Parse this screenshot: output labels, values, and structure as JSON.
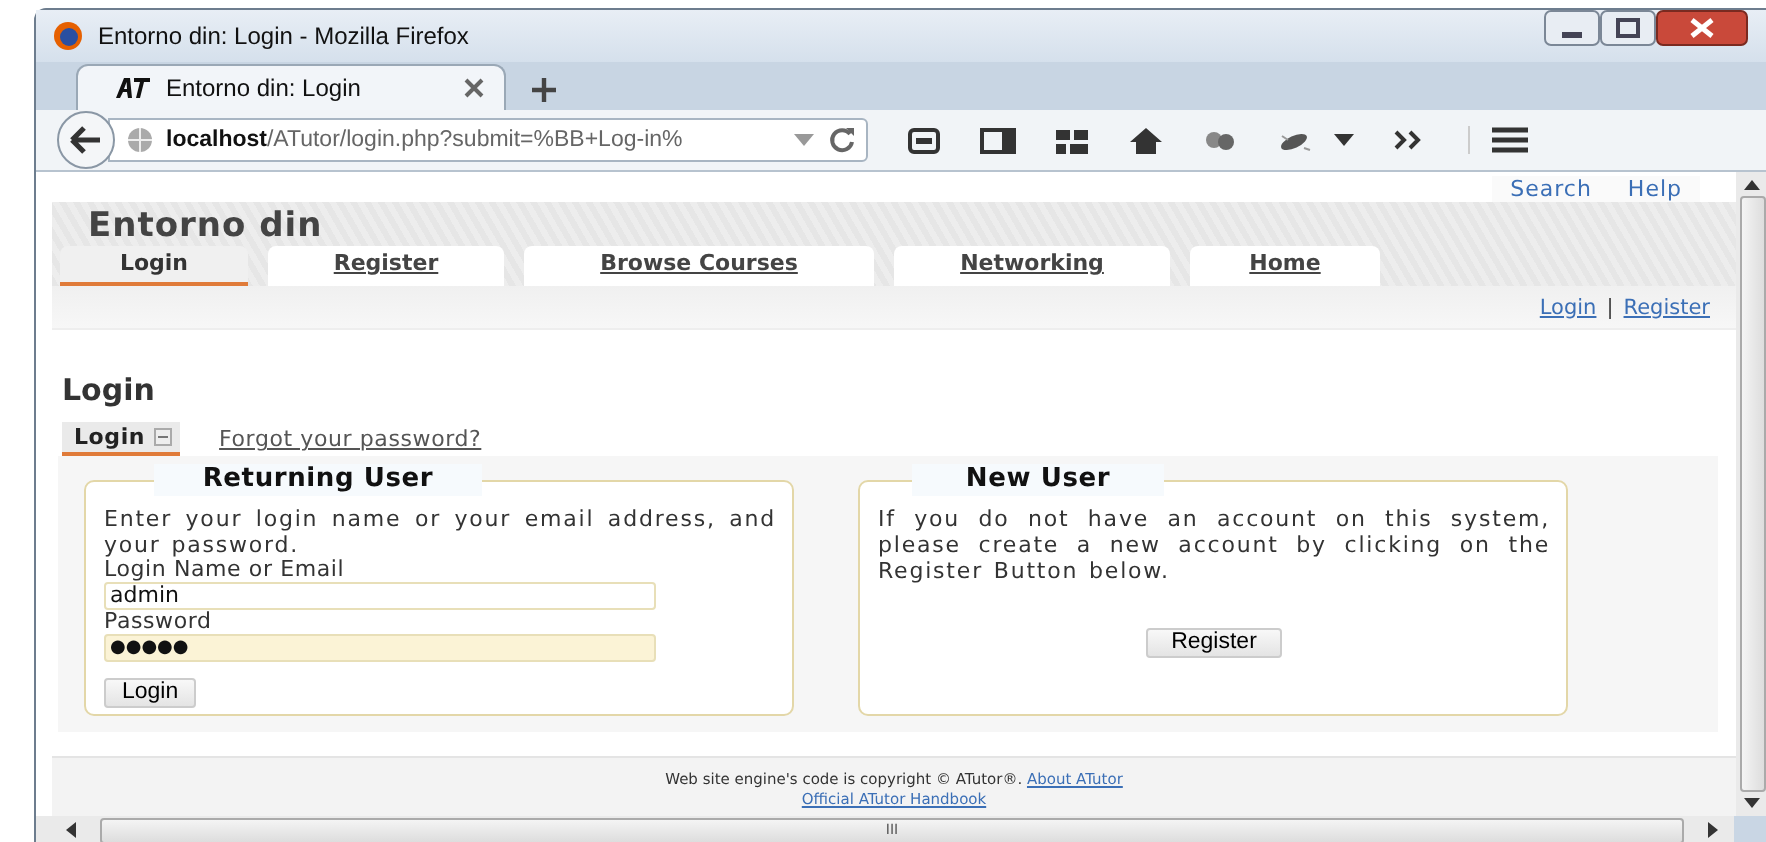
{
  "window": {
    "title": "Entorno din: Login - Mozilla Firefox"
  },
  "browser_tabs": [
    {
      "label": "Entorno din: Login",
      "selected": true
    }
  ],
  "address_bar": {
    "host": "localhost",
    "path": "/ATutor/login.php?submit=%BB+Log-in%"
  },
  "page": {
    "top_links": [
      "Search",
      "Help"
    ],
    "site_title": "Entorno din",
    "nav_tabs": [
      {
        "label": "Login",
        "selected": true
      },
      {
        "label": "Register",
        "selected": false
      },
      {
        "label": "Browse Courses",
        "selected": false
      },
      {
        "label": "Networking",
        "selected": false
      },
      {
        "label": "Home",
        "selected": false
      }
    ],
    "user_links": [
      "Login",
      "Register"
    ],
    "user_links_separator": "|",
    "heading": "Login",
    "sub_tabs": [
      {
        "label": "Login",
        "selected": true
      },
      {
        "label": "Forgot your password?",
        "selected": false
      }
    ],
    "returning_user": {
      "legend": "Returning User",
      "text": "Enter your login name or your email address, and your password.",
      "login_label": "Login Name or Email",
      "login_value": "admin",
      "password_label": "Password",
      "password_value": "●●●●●",
      "button": "Login"
    },
    "new_user": {
      "legend": "New User",
      "text": "If you do not have an account on this system, please create a new account by clicking on the Register Button below.",
      "button": "Register"
    },
    "footer": {
      "text": "Web site engine's code is copyright © ATutor®.",
      "about_link": "About ATutor",
      "handbook_link": "Official ATutor Handbook"
    }
  },
  "scrollbar_grip": "III"
}
